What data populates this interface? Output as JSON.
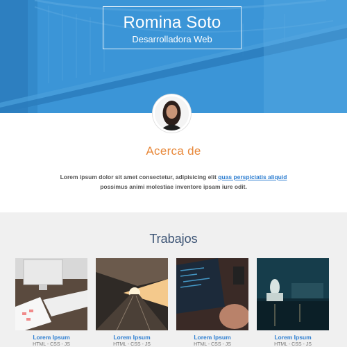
{
  "hero": {
    "name": "Romina Soto",
    "role": "Desarrolladora Web"
  },
  "about": {
    "title": "Acerca de",
    "text_before": "Lorem ipsum dolor sit amet consectetur, adipisicing elit ",
    "link": "quas perspiciatis aliquid",
    "text_after": " possimus animi molestiae inventore ipsam iure odit."
  },
  "works": {
    "title": "Trabajos",
    "items": [
      {
        "title": "Lorem Ipsum",
        "tags": "HTML - CSS - JS"
      },
      {
        "title": "Lorem Ipsum",
        "tags": "HTML - CSS - JS"
      },
      {
        "title": "Lorem Ipsum",
        "tags": "HTML - CSS - JS"
      },
      {
        "title": "Lorem Ipsum",
        "tags": "HTML - CSS - JS"
      }
    ]
  },
  "colors": {
    "hero_blue": "#3a94d6",
    "accent_orange": "#e8883a",
    "link_blue": "#2f7fd1",
    "heading_navy": "#3a5273"
  }
}
